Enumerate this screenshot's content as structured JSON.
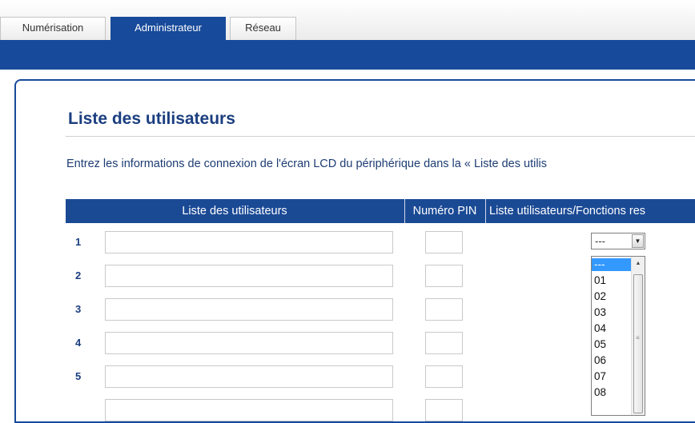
{
  "tabs": [
    {
      "label": "Numérisation",
      "active": false
    },
    {
      "label": "Administrateur",
      "active": true
    },
    {
      "label": "Réseau",
      "active": false
    }
  ],
  "page": {
    "title": "Liste des utilisateurs",
    "description": "Entrez les informations de connexion de l'écran LCD du périphérique dans la « Liste des utilis"
  },
  "table": {
    "headers": [
      "Liste des utilisateurs",
      "Numéro PIN",
      "Liste utilisateurs/Fonctions res"
    ],
    "rows": [
      {
        "num": "1",
        "name": "",
        "pin": ""
      },
      {
        "num": "2",
        "name": "",
        "pin": ""
      },
      {
        "num": "3",
        "name": "",
        "pin": ""
      },
      {
        "num": "4",
        "name": "",
        "pin": ""
      },
      {
        "num": "5",
        "name": "",
        "pin": ""
      }
    ]
  },
  "function_select": {
    "selected_value": "---",
    "options": [
      "---",
      "01",
      "02",
      "03",
      "04",
      "05",
      "06",
      "07",
      "08"
    ]
  },
  "colors": {
    "accent": "#174a9a",
    "header_bg": "#1b4a95",
    "title": "#1b3e7f",
    "selected_option": "#3399ff"
  },
  "icons": {
    "select_arrow": "chevron-down-icon",
    "scroll_up": "scroll-up-icon"
  }
}
